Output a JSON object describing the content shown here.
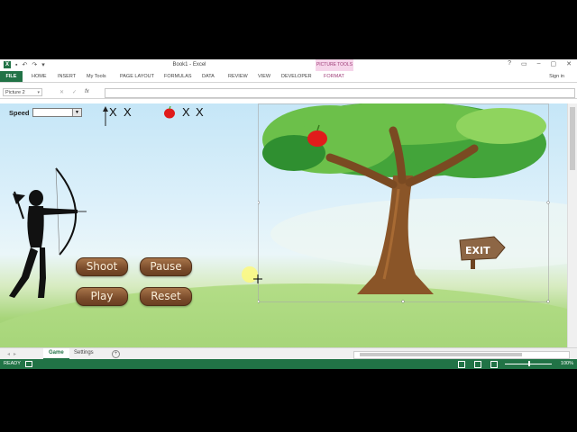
{
  "window": {
    "title": "Book1 - Excel",
    "context_group": "PICTURE TOOLS",
    "controls": [
      "?",
      "▭",
      "–",
      "▢",
      "✕"
    ],
    "quick_access": [
      "↶",
      "↷",
      "▾"
    ]
  },
  "ribbon": {
    "tabs": [
      "FILE",
      "HOME",
      "INSERT",
      "My Tools",
      "PAGE LAYOUT",
      "FORMULAS",
      "DATA",
      "REVIEW",
      "VIEW",
      "DEVELOPER",
      "FORMAT"
    ],
    "active_context_tab": "FORMAT",
    "sign_in": "Sign in"
  },
  "formula_bar": {
    "name_box": "Picture 2",
    "fx": "fx",
    "cancel": "✕",
    "enter": "✓",
    "value": ""
  },
  "game": {
    "speed_label": "Speed",
    "speed_value": "",
    "arrow_marks": [
      "X",
      "X"
    ],
    "apple_marks": [
      "X",
      "X"
    ],
    "buttons": {
      "shoot": "Shoot",
      "pause": "Pause",
      "play": "Play",
      "reset": "Reset"
    },
    "exit_sign": "EXIT"
  },
  "sheet_tabs": {
    "tabs": [
      "Game",
      "Settings"
    ],
    "active": "Game",
    "add": "+"
  },
  "status": {
    "ready": "READY",
    "zoom": "100%",
    "colors": {
      "excel_green": "#217346",
      "button_wood": "#7b4c2b"
    }
  }
}
